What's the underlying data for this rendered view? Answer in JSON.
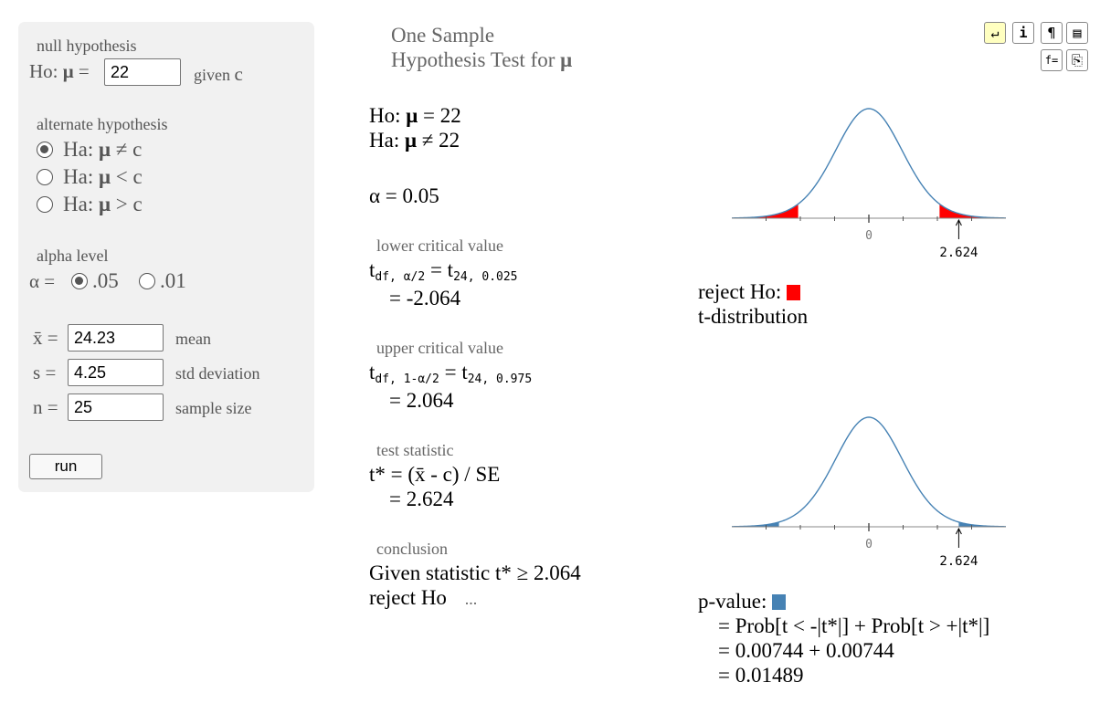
{
  "title": {
    "line1": "One Sample",
    "line2": "Hypothesis Test for",
    "mu": "μ"
  },
  "form": {
    "null_label": "null hypothesis",
    "ho_prefix": "Ho:",
    "mu": "μ",
    "eq": "=",
    "c_value": "22",
    "given_prefix": "given",
    "given_c": "c",
    "alt_label": "alternate hypothesis",
    "alternatives": [
      {
        "text": "Ha:",
        "op": "≠ c",
        "selected": true
      },
      {
        "text": "Ha:",
        "op": "< c",
        "selected": false
      },
      {
        "text": "Ha:",
        "op": "> c",
        "selected": false
      }
    ],
    "alpha_label": "alpha level",
    "alpha_prefix": "α =",
    "alpha_options": [
      {
        "label": ".05",
        "selected": true
      },
      {
        "label": ".01",
        "selected": false
      }
    ],
    "xbar_sym": "x̄",
    "xbar_value": "24.23",
    "xbar_desc": "mean",
    "s_sym": "s",
    "s_value": "4.25",
    "s_desc": "std deviation",
    "n_sym": "n",
    "n_value": "25",
    "n_desc": "sample size",
    "run_label": "run"
  },
  "results": {
    "ho": "Ho:",
    "ho_val": "= 22",
    "ha": "Ha:",
    "ha_val": "≠ 22",
    "alpha": "α = 0.05",
    "lower_hdr": "lower critical value",
    "lower_t": "t",
    "lower_sub": "df, α/2",
    "lower_eq": "= t",
    "lower_sub2": "24, 0.025",
    "lower_val": "= -2.064",
    "upper_hdr": "upper critical value",
    "upper_t": "t",
    "upper_sub": "df, 1-α/2",
    "upper_eq": "= t",
    "upper_sub2": "24, 0.975",
    "upper_val": "= 2.064",
    "ts_hdr": "test statistic",
    "ts_formula": "t* = (x̄ - c) / SE",
    "ts_val": "= 2.624",
    "concl_hdr": "conclusion",
    "concl_line1": "Given statistic t* ≥ 2.064",
    "concl_line2": "reject Ho",
    "concl_more": "..."
  },
  "plots": {
    "zero_label": "0",
    "stat_label": "2.624",
    "reject_label": "reject Ho:",
    "dist_label": "t-distribution",
    "pval_label": "p-value:",
    "pval_line1": "= Prob[t < -|t*|] + Prob[t > +|t*|]",
    "pval_line2": "= 0.00744 + 0.00744",
    "pval_line3": "= 0.01489",
    "reject_color": "#ff0000",
    "pval_color": "#4682b4",
    "curve_color": "#4682b4"
  },
  "toolbar": {
    "buttons": [
      {
        "name": "return-icon",
        "glyph": "↵"
      },
      {
        "name": "info-icon",
        "glyph": "i"
      },
      {
        "name": "code-icon",
        "glyph": "¶"
      },
      {
        "name": "notebook-icon",
        "glyph": "▤"
      },
      {
        "name": "formula-icon",
        "glyph": "f="
      },
      {
        "name": "clip-icon",
        "glyph": "⎘"
      }
    ]
  }
}
